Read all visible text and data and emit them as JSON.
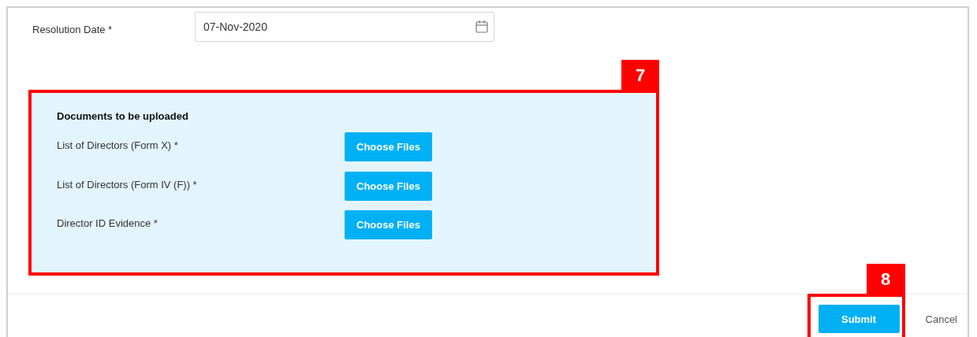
{
  "resolution_date": {
    "label": "Resolution Date *",
    "value": "07-Nov-2020"
  },
  "documents": {
    "title": "Documents to be uploaded",
    "items": [
      {
        "label": "List of Directors (Form X) *",
        "button": "Choose Files"
      },
      {
        "label": "List of Directors (Form IV (F)) *",
        "button": "Choose Files"
      },
      {
        "label": "Director ID Evidence *",
        "button": "Choose Files"
      }
    ],
    "annotation": "7"
  },
  "footer": {
    "submit": "Submit",
    "submit_annotation": "8",
    "cancel": "Cancel"
  }
}
